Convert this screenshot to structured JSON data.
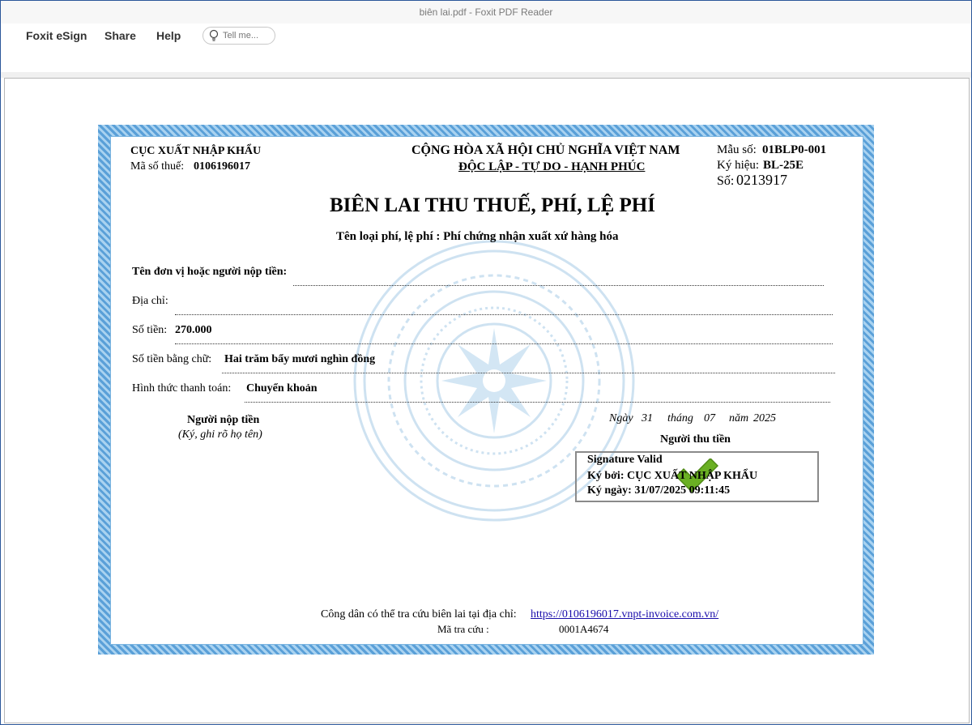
{
  "window": {
    "title": "biên lai.pdf - Foxit PDF Reader"
  },
  "ribbon": {
    "menus": [
      "Foxit eSign",
      "Share",
      "Help"
    ],
    "tell_me_placeholder": "Tell me..."
  },
  "receipt": {
    "issuer_name": "CỤC XUẤT NHẬP KHẨU",
    "tax_code_label": "Mã số thuế:",
    "tax_code_value": "0106196017",
    "national_title": "CỘNG HÒA XÃ HỘI CHỦ NGHĨA VIỆT NAM",
    "motto": "ĐỘC LẬP - TỰ DO - HẠNH PHÚC",
    "form_label": "Mẫu số:",
    "form_value": "01BLP0-001",
    "symbol_label": "Ký hiệu:",
    "symbol_value": "BL-25E",
    "number_label": "Số:",
    "number_value": "0213917",
    "main_title": "BIÊN LAI THU THUẾ, PHÍ, LỆ PHÍ",
    "fee_type": "Tên loại phí, lệ phí : Phí chứng nhận xuất xứ hàng hóa",
    "payer_label": "Tên đơn vị hoặc người nộp tiền:",
    "address_label": "Địa chỉ:",
    "amount_label": "Số tiền:",
    "amount_value": "270.000",
    "amount_words_label": "Số tiền bằng chữ:",
    "amount_words_value": "Hai trăm bẩy mươi nghìn đồng",
    "payment_method_label": "Hình thức thanh toán:",
    "payment_method_value": "Chuyển khoản",
    "payer_sign_title": "Người nộp tiền",
    "payer_sign_note": "(Ký, ghi rõ họ tên)",
    "date_day_label": "Ngày",
    "date_day": "31",
    "date_month_label": "tháng",
    "date_month": "07",
    "date_year_label": "năm",
    "date_year": "2025",
    "collector_title": "Người thu tiền",
    "signature": {
      "status": "Signature Valid",
      "signed_by": "Ký bởi: CỤC XUẤT NHẬP KHẨU",
      "signed_date": "Ký ngày: 31/07/2025 09:11:45"
    },
    "lookup_text": "Công dân có thể tra cứu biên lai tại địa chỉ:",
    "lookup_url": "https://0106196017.vnpt-invoice.com.vn/",
    "lookup_code_label": "Mã tra cứu :",
    "lookup_code_value": "0001A4674"
  },
  "colors": {
    "border_dark": "#5aa0d8",
    "border_light": "#a9d2f0",
    "check": "#6ab023"
  }
}
